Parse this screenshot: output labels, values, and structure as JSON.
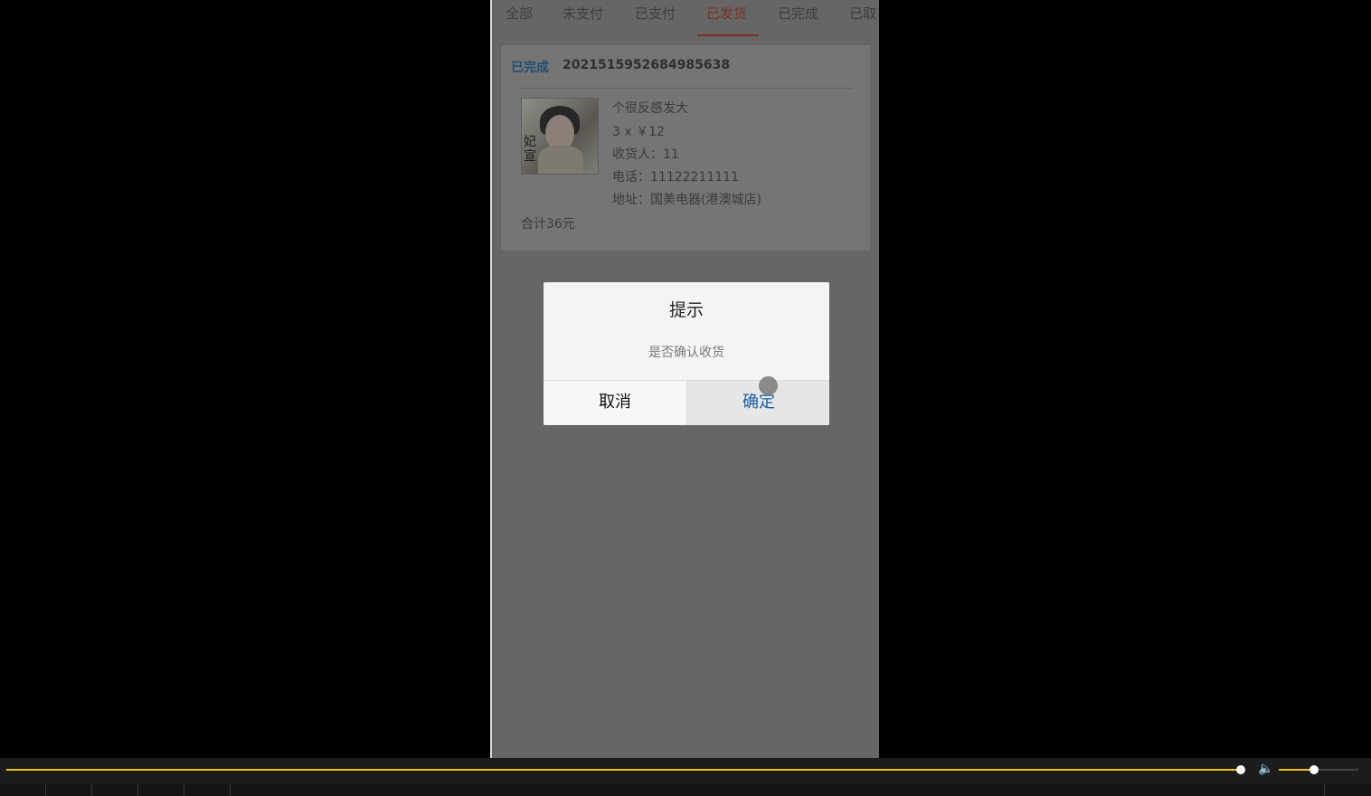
{
  "tabs": [
    {
      "label": "全部"
    },
    {
      "label": "未支付"
    },
    {
      "label": "已支付"
    },
    {
      "label": "已发货"
    },
    {
      "label": "已完成"
    },
    {
      "label": "已取"
    }
  ],
  "active_tab": "已发货",
  "order": {
    "status": "已完成",
    "order_no": "2021515952684985638",
    "product_name": "个很反感发大",
    "quantity_price": "3 x ￥12",
    "recipient": "收货人：11",
    "phone": "电话：11122211111",
    "address": "地址：国美电器(港澳城店)",
    "total": "合计36元",
    "thumbnail_text": "妃宣"
  },
  "dialog": {
    "title": "提示",
    "message": "是否确认收货",
    "cancel_label": "取消",
    "confirm_label": "确定"
  },
  "player": {
    "seek_progress": 0.9,
    "volume_level": 0.44,
    "accent_color": "#f0c419"
  },
  "colors": {
    "active_tab": "#7a3322",
    "status": "#1f4d75",
    "confirm": "#1b5fa2"
  },
  "icons": {
    "volume": "volume-icon"
  }
}
